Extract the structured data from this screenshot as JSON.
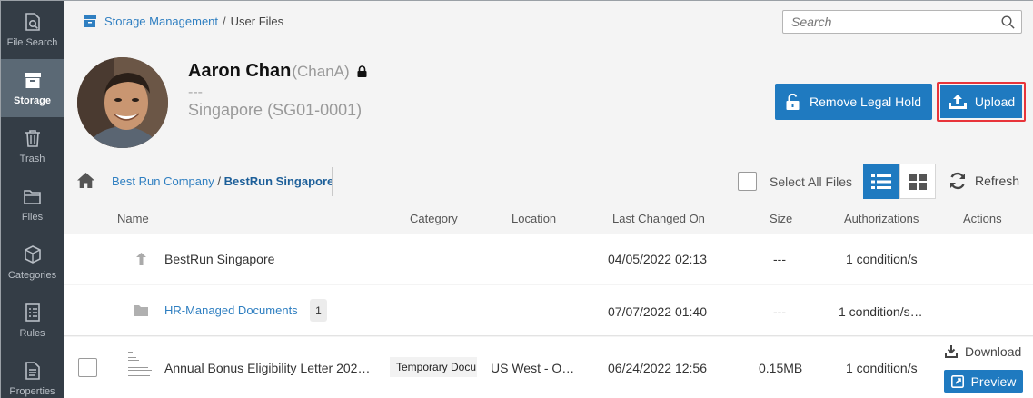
{
  "sidebar": {
    "items": [
      {
        "label": "File Search",
        "icon": "file-search-icon"
      },
      {
        "label": "Storage",
        "icon": "storage-box-icon",
        "active": true
      },
      {
        "label": "Trash",
        "icon": "trash-icon"
      },
      {
        "label": "Files",
        "icon": "folder-icon"
      },
      {
        "label": "Categories",
        "icon": "cube-icon"
      },
      {
        "label": "Rules",
        "icon": "rules-list-icon"
      },
      {
        "label": "Properties",
        "icon": "properties-doc-icon"
      }
    ]
  },
  "breadcrumb_top": {
    "root": "Storage Management",
    "separator": "/",
    "current": "User Files"
  },
  "search": {
    "placeholder": "Search",
    "value": ""
  },
  "user": {
    "name": "Aaron Chan",
    "id": "(ChanA)",
    "line2": "---",
    "location": "Singapore (SG01-0001)"
  },
  "actions": {
    "remove_legal_hold": "Remove Legal Hold",
    "upload": "Upload"
  },
  "folder_path": {
    "parent": "Best Run Company",
    "separator": "/",
    "current": "BestRun Singapore"
  },
  "toolbar": {
    "select_all": "Select All Files",
    "refresh": "Refresh",
    "view": "list"
  },
  "columns": {
    "name": "Name",
    "category": "Category",
    "location": "Location",
    "last_changed": "Last Changed On",
    "size": "Size",
    "authorizations": "Authorizations",
    "actions": "Actions"
  },
  "rows": [
    {
      "type": "parent",
      "name": "BestRun Singapore",
      "category": "",
      "location": "",
      "last_changed": "04/05/2022 02:13",
      "size": "---",
      "authorizations": "1 condition/s"
    },
    {
      "type": "folder",
      "name": "HR-Managed Documents",
      "count": "1",
      "category": "",
      "location": "",
      "last_changed": "07/07/2022 01:40",
      "size": "---",
      "authorizations": "1 condition/s…"
    },
    {
      "type": "file",
      "name": "Annual Bonus Eligibility Letter 202…",
      "category": "Temporary Docu",
      "location": "US West - O…",
      "last_changed": "06/24/2022 12:56",
      "size": "0.15MB",
      "authorizations": "1 condition/s",
      "download": "Download",
      "preview": "Preview"
    }
  ],
  "colors": {
    "sidebar_bg": "#343d46",
    "sidebar_active": "#5b6975",
    "primary": "#1f7ac0",
    "link": "#2f7fc1",
    "highlight_border": "#e8343a"
  }
}
